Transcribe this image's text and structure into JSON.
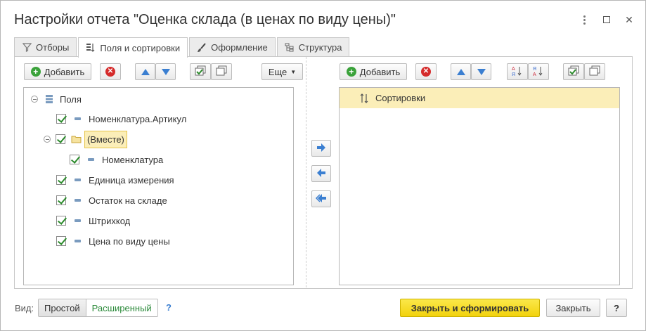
{
  "window": {
    "title": "Настройки отчета \"Оценка склада (в ценах по виду цены)\""
  },
  "tabs": [
    {
      "label": "Отборы",
      "icon": "filter-icon"
    },
    {
      "label": "Поля и сортировки",
      "icon": "fields-sort-icon",
      "active": true
    },
    {
      "label": "Оформление",
      "icon": "brush-icon"
    },
    {
      "label": "Структура",
      "icon": "structure-icon"
    }
  ],
  "left_toolbar": {
    "add_label": "Добавить",
    "more_label": "Еще"
  },
  "right_toolbar": {
    "add_label": "Добавить"
  },
  "fields_tree": {
    "root_label": "Поля",
    "items": [
      {
        "label": "Номенклатура.Артикул",
        "checked": true
      },
      {
        "label": "(Вместе)",
        "checked": true,
        "group": true
      },
      {
        "label": "Номенклатура",
        "checked": true
      },
      {
        "label": "Единица измерения",
        "checked": true
      },
      {
        "label": "Остаток на складе",
        "checked": true
      },
      {
        "label": "Штрихкод",
        "checked": true
      },
      {
        "label": "Цена по виду цены",
        "checked": true
      }
    ]
  },
  "sort_tree": {
    "root_label": "Сортировки"
  },
  "footer": {
    "view_label": "Вид:",
    "mode_simple": "Простой",
    "mode_advanced": "Расширенный",
    "help": "?",
    "close_and_run": "Закрыть и сформировать",
    "close": "Закрыть",
    "help_button": "?"
  },
  "colors": {
    "accent_yellow": "#f5d914",
    "selection": "#fbeeb8",
    "check_green": "#2b8a2b",
    "arrow_blue": "#3b7fd1"
  }
}
